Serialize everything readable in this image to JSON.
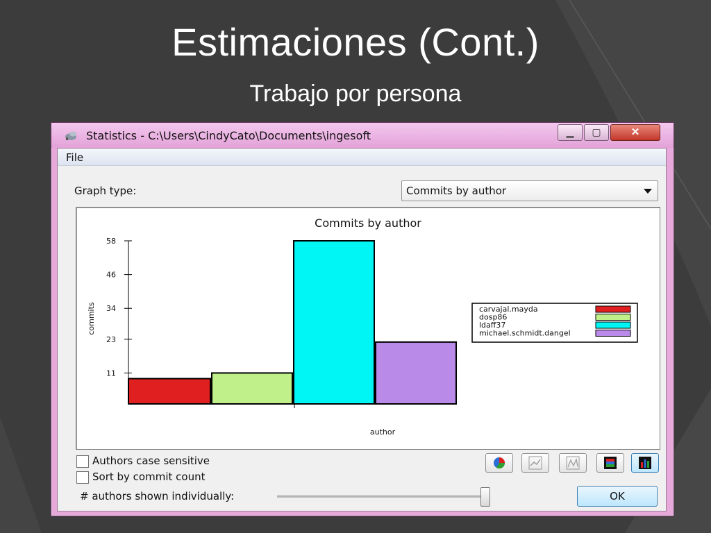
{
  "slide": {
    "title": "Estimaciones (Cont.)",
    "subtitle": "Trabajo por persona"
  },
  "window": {
    "title": "Statistics - C:\\Users\\CindyCato\\Documents\\ingesoft",
    "minimize_icon": "minimize-icon",
    "maximize_icon": "maximize-icon",
    "close_icon": "close-icon"
  },
  "menu": {
    "file": "File"
  },
  "graph_type": {
    "label": "Graph type:",
    "selected": "Commits by author"
  },
  "options": {
    "case_sensitive": {
      "label": "Authors case sensitive",
      "checked": false
    },
    "sort_by_count": {
      "label": "Sort by commit count",
      "checked": false
    },
    "authors_shown_label": "# authors shown individually:",
    "authors_shown_level": 1.0
  },
  "buttons": {
    "ok": "OK",
    "view_icons": [
      "pie-chart-icon",
      "line-chart-icon",
      "scatter-chart-icon",
      "stacked-bar-icon",
      "bar-chart-icon"
    ]
  },
  "chart_data": {
    "type": "bar",
    "title": "Commits by author",
    "xlabel": "author",
    "ylabel": "commits",
    "ylim": [
      0,
      58
    ],
    "yticks": [
      "58",
      "46",
      "34",
      "23",
      "11"
    ],
    "legend_position": "right",
    "series": [
      {
        "name": "carvajal.mayda",
        "value": 9,
        "color": "#e02020"
      },
      {
        "name": "dosp86",
        "value": 11,
        "color": "#c0f08a"
      },
      {
        "name": "ldaff37",
        "value": 58,
        "color": "#00f5f5"
      },
      {
        "name": "michael.schmidt.dangel",
        "value": 22,
        "color": "#b98ae8"
      }
    ]
  }
}
